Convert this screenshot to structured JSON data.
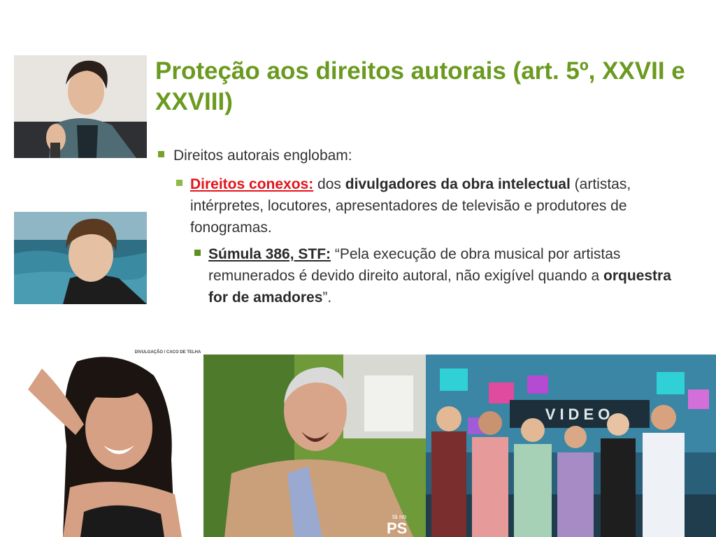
{
  "slide": {
    "title": "Proteção aos direitos autorais (art. 5º, XXVII e XXVIII)",
    "bullet1": "Direitos autorais englobam:",
    "bullet2": {
      "lead": "Direitos conexos:",
      "t1": " dos ",
      "bold": "divulgadores da obra intelectual",
      "t2": " (artistas, intérpretes, locutores, apresentadores de televisão e produtores de fonogramas."
    },
    "bullet3": {
      "lead": "Súmula 386, STF:",
      "t1": " “Pela execução de obra musical por artistas remunerados é devido direito autoral, não exigível quando a ",
      "bold": "orquestra for de amadores",
      "t2": "”."
    },
    "photo_credit": "DIVULGAÇÃO / CACO DE TELHA",
    "tv_logo": "PS",
    "tv_logo_small": "tá no",
    "studio_sign": "VIDEO"
  },
  "colors": {
    "title": "#6a9a1f",
    "highlight": "#e3141b",
    "text": "#333333"
  }
}
